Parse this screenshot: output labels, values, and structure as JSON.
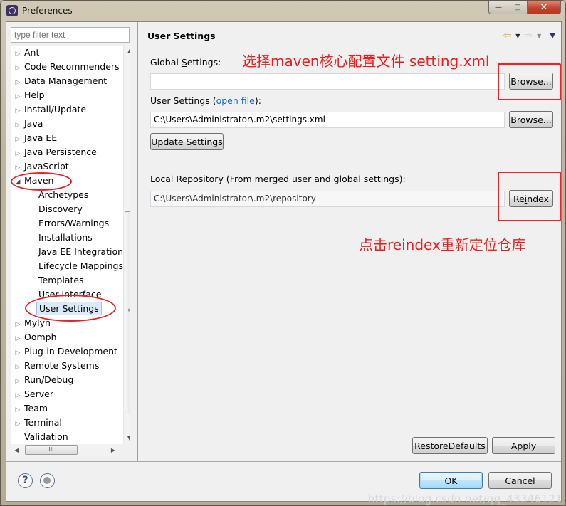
{
  "window": {
    "title": "Preferences",
    "controls": {
      "minimize": "—",
      "maximize": "□",
      "close": "✕"
    }
  },
  "sidebar": {
    "filter_placeholder": "type filter text",
    "tree": [
      {
        "label": "Ant",
        "level": 0,
        "twisty": "collapsed"
      },
      {
        "label": "Code Recommenders",
        "level": 0,
        "twisty": "collapsed"
      },
      {
        "label": "Data Management",
        "level": 0,
        "twisty": "collapsed"
      },
      {
        "label": "Help",
        "level": 0,
        "twisty": "collapsed"
      },
      {
        "label": "Install/Update",
        "level": 0,
        "twisty": "collapsed"
      },
      {
        "label": "Java",
        "level": 0,
        "twisty": "collapsed"
      },
      {
        "label": "Java EE",
        "level": 0,
        "twisty": "collapsed"
      },
      {
        "label": "Java Persistence",
        "level": 0,
        "twisty": "collapsed"
      },
      {
        "label": "JavaScript",
        "level": 0,
        "twisty": "collapsed"
      },
      {
        "label": "Maven",
        "level": 0,
        "twisty": "expanded"
      },
      {
        "label": "Archetypes",
        "level": 1,
        "twisty": "none"
      },
      {
        "label": "Discovery",
        "level": 1,
        "twisty": "none"
      },
      {
        "label": "Errors/Warnings",
        "level": 1,
        "twisty": "none"
      },
      {
        "label": "Installations",
        "level": 1,
        "twisty": "none"
      },
      {
        "label": "Java EE Integration",
        "level": 1,
        "twisty": "none"
      },
      {
        "label": "Lifecycle Mappings",
        "level": 1,
        "twisty": "none"
      },
      {
        "label": "Templates",
        "level": 1,
        "twisty": "none"
      },
      {
        "label": "User Interface",
        "level": 1,
        "twisty": "none"
      },
      {
        "label": "User Settings",
        "level": 1,
        "twisty": "none",
        "selected": true
      },
      {
        "label": "Mylyn",
        "level": 0,
        "twisty": "collapsed"
      },
      {
        "label": "Oomph",
        "level": 0,
        "twisty": "collapsed"
      },
      {
        "label": "Plug-in Development",
        "level": 0,
        "twisty": "collapsed"
      },
      {
        "label": "Remote Systems",
        "level": 0,
        "twisty": "collapsed"
      },
      {
        "label": "Run/Debug",
        "level": 0,
        "twisty": "collapsed"
      },
      {
        "label": "Server",
        "level": 0,
        "twisty": "collapsed"
      },
      {
        "label": "Team",
        "level": 0,
        "twisty": "collapsed"
      },
      {
        "label": "Terminal",
        "level": 0,
        "twisty": "collapsed"
      },
      {
        "label": "Validation",
        "level": 0,
        "twisty": "none"
      }
    ],
    "scroll": {
      "up": "▲",
      "down": "▼",
      "left": "◀",
      "right": "▶",
      "grip": "≡",
      "hgrip": "III"
    }
  },
  "page": {
    "title": "User Settings",
    "nav": {
      "back": "⇦",
      "forward": "⇨",
      "dropdown": "▼",
      "menu": "▼"
    },
    "global_settings": {
      "label_pre": "Global ",
      "label_mnemonic": "S",
      "label_post": "ettings:",
      "value": "",
      "browse_label": "Browse..."
    },
    "user_settings": {
      "label_pre": "User ",
      "label_mnemonic": "S",
      "label_post": "ettings (",
      "link": "open file",
      "label_end": "):",
      "value": "C:\\Users\\Administrator\\.m2\\settings.xml",
      "browse_label": "Browse..."
    },
    "update_settings_label": "Update Settings",
    "local_repository": {
      "label": "Local Repository (From merged user and global settings):",
      "value": "C:\\Users\\Administrator\\.m2\\repository",
      "reindex_pre": "Re",
      "reindex_mnemonic": "i",
      "reindex_post": "ndex"
    },
    "restore_defaults": {
      "pre": "Restore ",
      "mnemonic": "D",
      "post": "efaults"
    },
    "apply": {
      "mnemonic": "A",
      "post": "pply"
    }
  },
  "footer": {
    "ok_label": "OK",
    "cancel_label": "Cancel"
  },
  "annotations": {
    "global_note": "选择maven核心配置文件 setting.xml",
    "reindex_note": "点击reindex重新定位仓库",
    "color": "#ee1c1c"
  },
  "watermark": "https://blog.csdn.net/qq_43346121"
}
